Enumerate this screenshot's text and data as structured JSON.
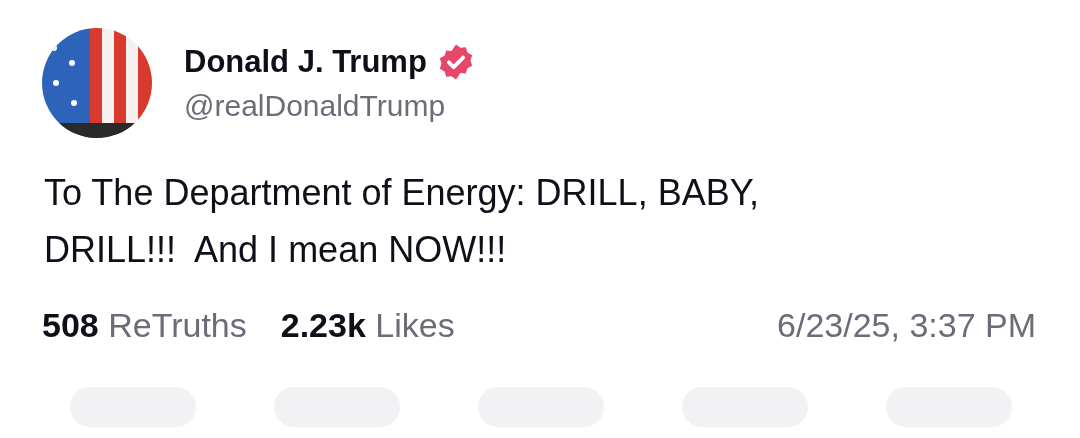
{
  "author": {
    "name": "Donald J. Trump",
    "verified": true,
    "handle": "@realDonaldTrump"
  },
  "post": {
    "text": "To The Department of Energy: DRILL, BABY, DRILL!!!  And I mean NOW!!!"
  },
  "stats": [
    {
      "count": "508",
      "label": "ReTruths"
    },
    {
      "count": "2.23k",
      "label": "Likes"
    }
  ],
  "timestamp": "6/23/25, 3:37 PM"
}
